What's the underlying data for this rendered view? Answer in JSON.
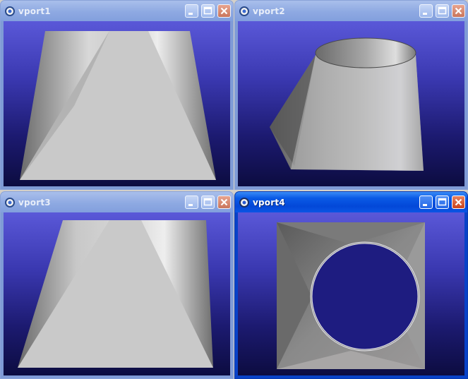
{
  "viewports": [
    {
      "title": "vport1",
      "active": false
    },
    {
      "title": "vport2",
      "active": false
    },
    {
      "title": "vport3",
      "active": false
    },
    {
      "title": "vport4",
      "active": true
    }
  ]
}
